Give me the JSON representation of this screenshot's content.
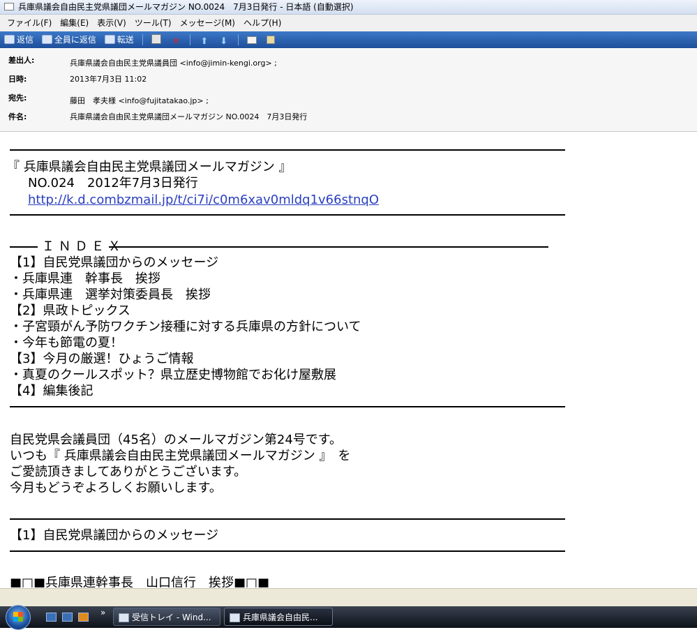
{
  "window": {
    "title": "兵庫県議会自由民主党県議団メールマガジン NO.0024　7月3日発行 - 日本語 (自動選択)"
  },
  "menu": [
    "ファイル(F)",
    "編集(E)",
    "表示(V)",
    "ツール(T)",
    "メッセージ(M)",
    "ヘルプ(H)"
  ],
  "toolbar": {
    "reply": "返信",
    "reply_all": "全員に返信",
    "forward": "転送"
  },
  "headers": {
    "from_label": "差出人:",
    "from": "兵庫県議会自由民主党県議員団 <info@jimin-kengi.org> ;",
    "date_label": "日時:",
    "date": "2013年7月3日 11:02",
    "to_label": "宛先:",
    "to": "藤田　孝夫様 <info@fujitatakao.jp> ;",
    "subject_label": "件名:",
    "subject": "兵庫県議会自由民主党県議団メールマガジン NO.0024　7月3日発行"
  },
  "body": {
    "mag_title": "『 兵庫県議会自由民主党県議団メールマガジン 』",
    "issue": "NO.024　2012年7月3日発行",
    "link": "http://k.d.combzmail.jp/t/ci7i/c0m6xav0mldq1v66stnqO",
    "index_label": "Ｉ Ｎ Ｄ Ｅ Ｘ",
    "index": [
      "【1】自民党県議団からのメッセージ",
      "・兵庫県連　幹事長　挨拶",
      "・兵庫県連　選挙対策委員長　挨拶",
      "【2】県政トピックス",
      "・子宮頸がん予防ワクチン接種に対する兵庫県の方針について",
      "・今年も節電の夏！",
      "【3】今月の厳選！ひょうご情報",
      "・真夏のクールスポット？県立歴史博物館でお化け屋敷展",
      "【4】編集後記"
    ],
    "intro": [
      "自民党県会議員団（45名）のメールマガジン第24号です。",
      "いつも『 兵庫県議会自由民主党県議団メールマガジン 』　を",
      "ご愛読頂きましてありがとうございます。",
      "今月もどうぞよろしくお願いします。"
    ],
    "section1": "【1】自民党県議団からのメッセージ",
    "section1_sub": "■□■兵庫県連幹事長　山口信行　挨拶■□■"
  },
  "taskbar": {
    "task1": "受信トレイ - Wind...",
    "task2": "兵庫県議会自由民..."
  }
}
